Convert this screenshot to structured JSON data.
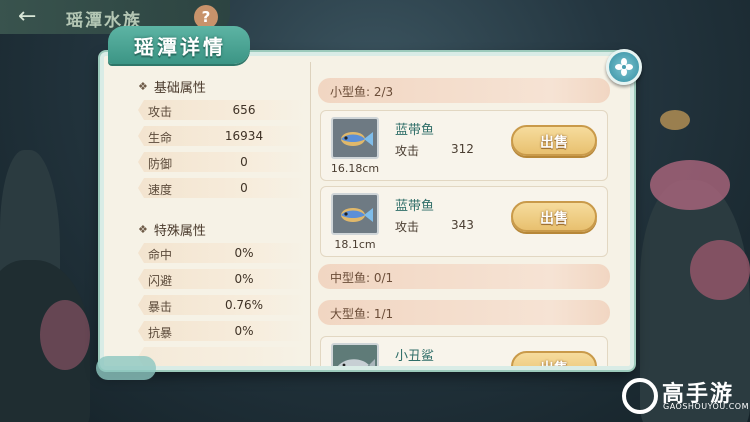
{
  "header": {
    "back_icon": "arrow-left-icon",
    "title": "瑶潭水族",
    "help_icon": "question-icon"
  },
  "panel": {
    "title": "瑶潭详情",
    "close_icon": "flower-close-icon"
  },
  "basic_attributes": {
    "heading": "基础属性",
    "rows": [
      {
        "label": "攻击",
        "value": "656"
      },
      {
        "label": "生命",
        "value": "16934"
      },
      {
        "label": "防御",
        "value": "0"
      },
      {
        "label": "速度",
        "value": "0"
      }
    ]
  },
  "special_attributes": {
    "heading": "特殊属性",
    "rows": [
      {
        "label": "命中",
        "value": "0%"
      },
      {
        "label": "闪避",
        "value": "0%"
      },
      {
        "label": "暴击",
        "value": "0.76%"
      },
      {
        "label": "抗暴",
        "value": "0%"
      }
    ]
  },
  "fish_categories": [
    {
      "label": "小型鱼: 2/3"
    },
    {
      "label": "中型鱼: 0/1"
    },
    {
      "label": "大型鱼: 1/1"
    }
  ],
  "fish": [
    {
      "name": "蓝带鱼",
      "size": "16.18cm",
      "attack_label": "攻击",
      "attack": "312",
      "sell_label": "出售"
    },
    {
      "name": "蓝带鱼",
      "size": "18.1cm",
      "attack_label": "攻击",
      "attack": "343",
      "sell_label": "出售"
    },
    {
      "name": "小丑鲨",
      "sell_label": "出售"
    }
  ],
  "watermark": {
    "text": "高手游",
    "sub": "GAOSHOUYOU.COM"
  },
  "colors": {
    "accent_teal": "#3c9585",
    "sell_gold": "#e8c06f",
    "panel_bg": "#f6f2e6"
  }
}
